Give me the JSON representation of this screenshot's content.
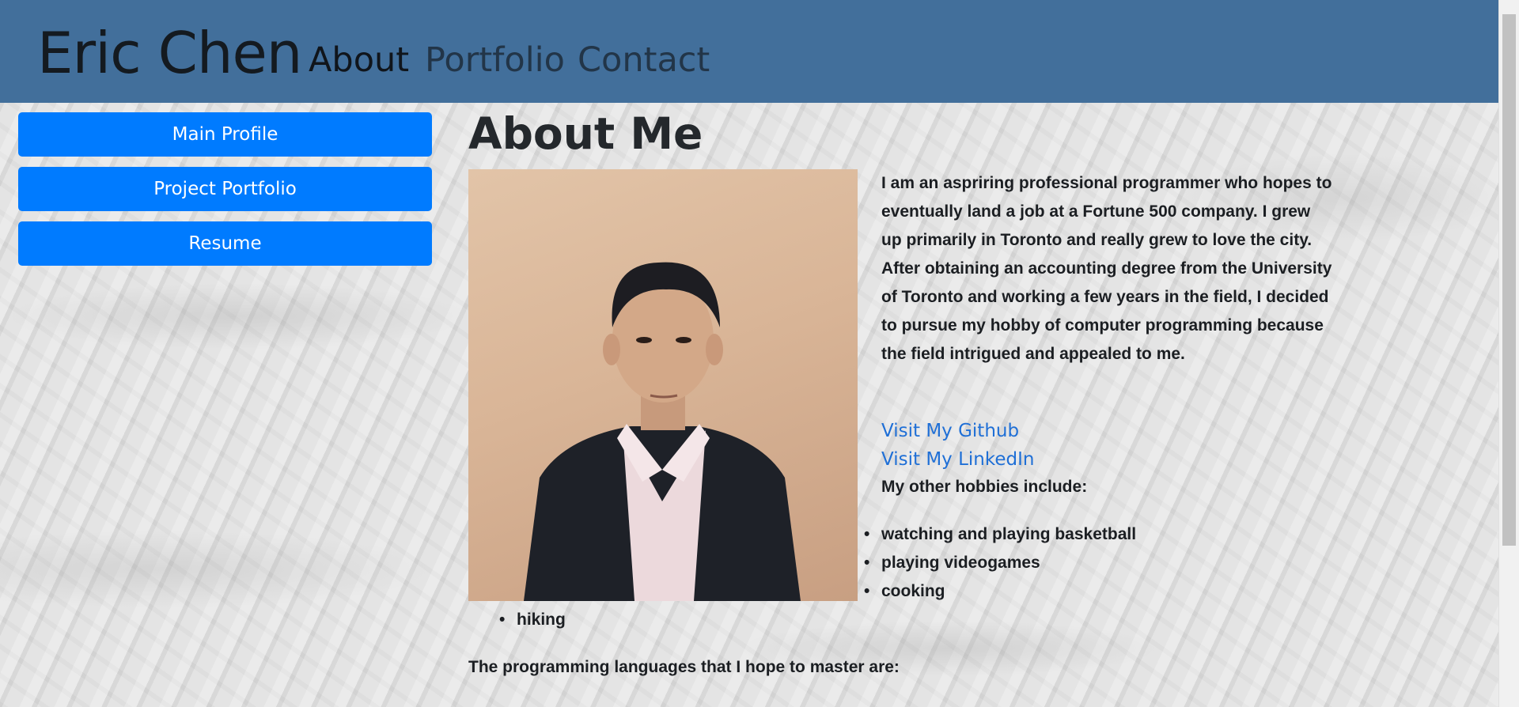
{
  "navbar": {
    "brand": "Eric Chen",
    "links": [
      {
        "label": "About",
        "active": true
      },
      {
        "label": "Portfolio",
        "active": false
      },
      {
        "label": "Contact",
        "active": false
      }
    ],
    "background_color": "#426f9b"
  },
  "sidebar": {
    "buttons": [
      {
        "label": "Main Profile"
      },
      {
        "label": "Project Portfolio"
      },
      {
        "label": "Resume"
      }
    ],
    "button_color": "#007bff"
  },
  "main": {
    "title": "About Me",
    "bio": "I am an aspriring professional programmer who hopes to eventually land a job at a Fortune 500 company. I grew up primarily in Toronto and really grew to love the city. After obtaining an accounting degree from the University of Toronto and working a few years in the field, I decided to pursue my hobby of computer programming because the field intrigued and appealed to me.",
    "github_link": "Visit My Github",
    "linkedin_link": "Visit My LinkedIn",
    "hobbies_label": "My other hobbies include:",
    "hobbies": [
      "watching and playing basketball",
      "playing videogames",
      "cooking",
      "hiking"
    ],
    "languages_label": "The programming languages that I hope to master are:"
  }
}
